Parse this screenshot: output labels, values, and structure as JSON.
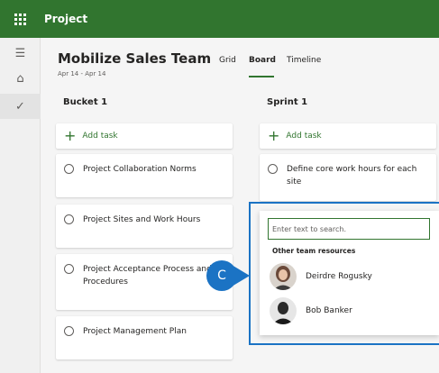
{
  "app": {
    "title": "Project",
    "brand_color": "#31752f",
    "launcher_icon": "app-launcher-icon"
  },
  "rail": {
    "items": [
      {
        "icon": "hamburger-icon",
        "glyph": "☰"
      },
      {
        "icon": "home-icon",
        "glyph": "⌂"
      },
      {
        "icon": "checkmark-icon",
        "glyph": "✓"
      }
    ]
  },
  "plan": {
    "title": "Mobilize Sales Team",
    "dates": "Apr 14 - Apr 14",
    "views": [
      {
        "label": "Grid",
        "active": false
      },
      {
        "label": "Board",
        "active": true
      },
      {
        "label": "Timeline",
        "active": false
      }
    ]
  },
  "buckets": [
    {
      "title": "Bucket 1",
      "add_task_label": "Add task",
      "tasks": [
        "Project Collaboration Norms",
        "Project Sites and Work Hours",
        "Project Acceptance Process and Procedures",
        "Project Management Plan"
      ]
    },
    {
      "title": "Sprint 1",
      "add_task_label": "Add task",
      "tasks": [
        "Define core work hours for each site"
      ]
    }
  ],
  "assign_picker": {
    "search_placeholder": "Enter text to search.",
    "section_label": "Other team resources",
    "people": [
      {
        "name": "Deirdre Rogusky",
        "avatar": "avatar-photo"
      },
      {
        "name": "Bob Banker",
        "avatar": "avatar-photo"
      }
    ]
  },
  "callout": {
    "letter": "C",
    "color": "#1b73c4"
  },
  "highlight_color": "#1b73c4"
}
